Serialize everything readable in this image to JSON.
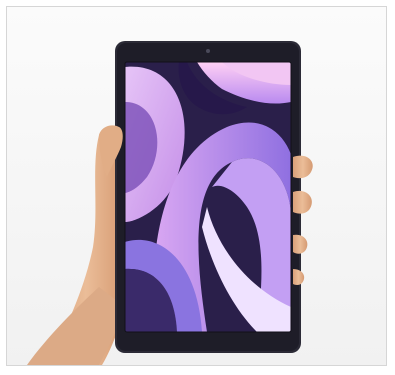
{
  "image": {
    "subject": "hand-holding-tablet-photo",
    "colors": {
      "background": "#f6f6f6",
      "frame_border": "#d6d6d6",
      "device_body": "#2a2a38",
      "screen_dark": "#1b1730",
      "purple": "#c888e8",
      "lavender": "#d8b6f2",
      "pink": "#e9a3e0",
      "skin": "#e6b38c"
    }
  }
}
